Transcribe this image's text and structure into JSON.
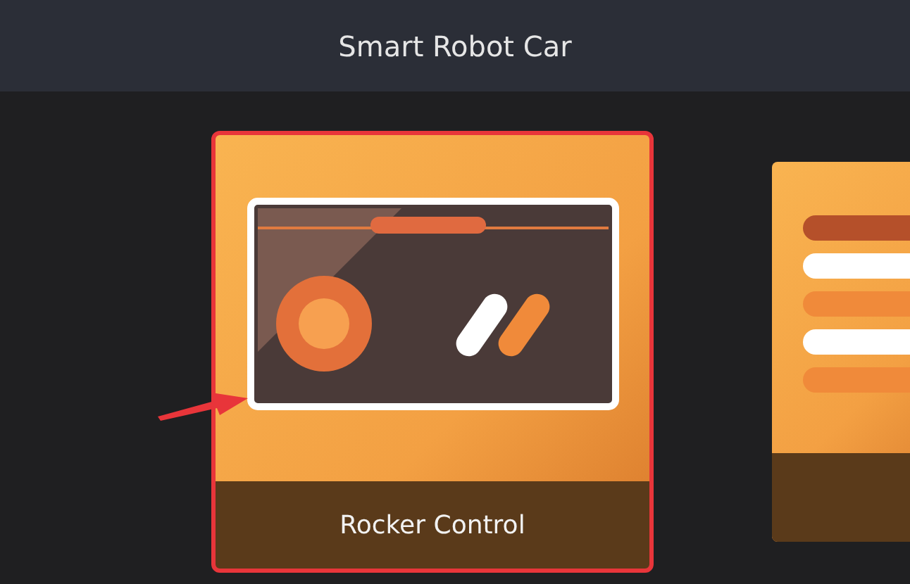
{
  "header": {
    "title": "Smart Robot Car"
  },
  "cards": [
    {
      "kind": "rocker",
      "label": "Rocker Control",
      "highlighted": true
    },
    {
      "kind": "stripes",
      "highlighted": false
    }
  ]
}
